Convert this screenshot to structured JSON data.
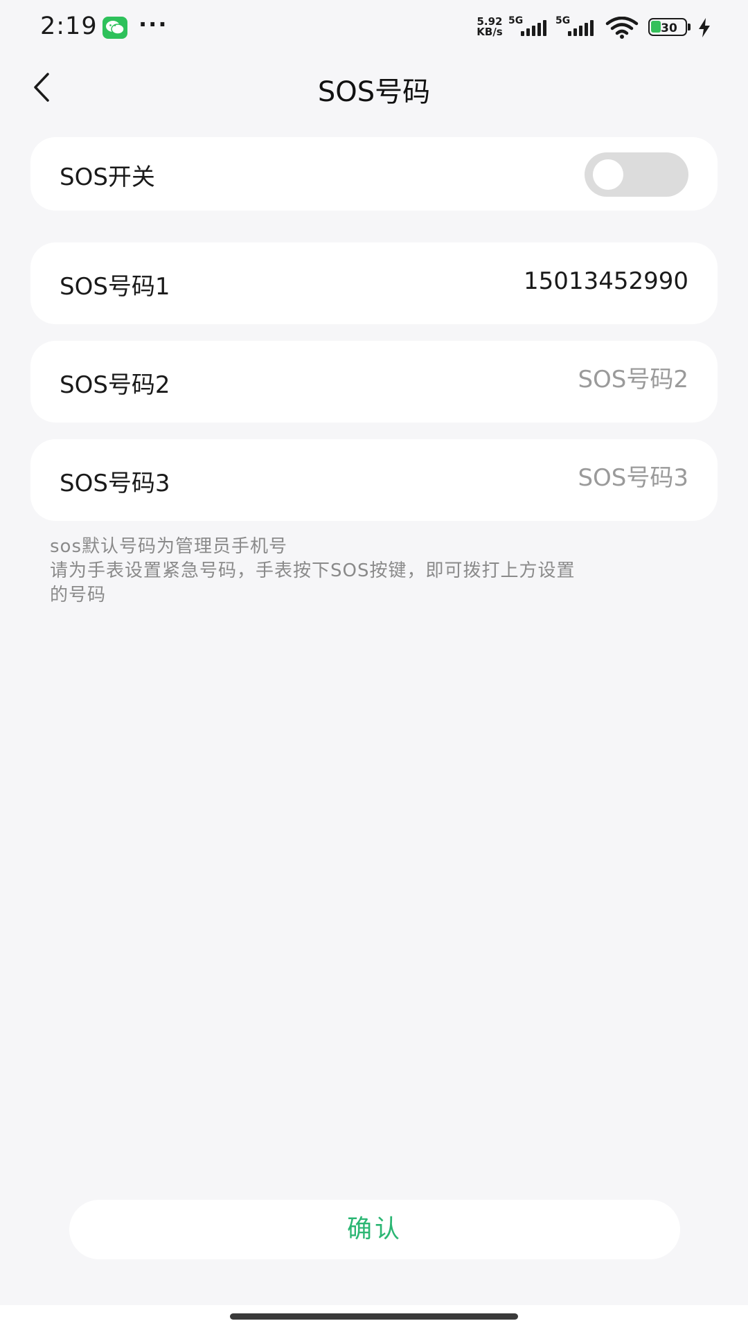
{
  "status_bar": {
    "time": "2:19",
    "more": "···",
    "net_speed_value": "5.92",
    "net_speed_unit": "KB/s",
    "signal_1_label": "5G",
    "signal_2_label": "5G",
    "battery_level": "30",
    "battery_fraction": 0.3,
    "icons": [
      "wechat-icon",
      "signal-icon",
      "wifi-icon",
      "battery-icon",
      "charging-icon"
    ]
  },
  "header": {
    "title": "SOS号码"
  },
  "sos_switch": {
    "label": "SOS开关",
    "enabled": false
  },
  "sos_numbers": [
    {
      "label": "SOS号码1",
      "value": "15013452990",
      "placeholder": ""
    },
    {
      "label": "SOS号码2",
      "value": "",
      "placeholder": "SOS号码2"
    },
    {
      "label": "SOS号码3",
      "value": "",
      "placeholder": "SOS号码3"
    }
  ],
  "hint": {
    "line1": "sos默认号码为管理员手机号",
    "line2": "请为手表设置紧急号码，手表按下SOS按键，即可拨打上方设置",
    "line3": "的号码"
  },
  "footer": {
    "confirm_label": "确认"
  },
  "colors": {
    "accent": "#2bb673",
    "background": "#f6f6f8",
    "card": "#ffffff",
    "toggle_off": "#dcdcdc"
  }
}
